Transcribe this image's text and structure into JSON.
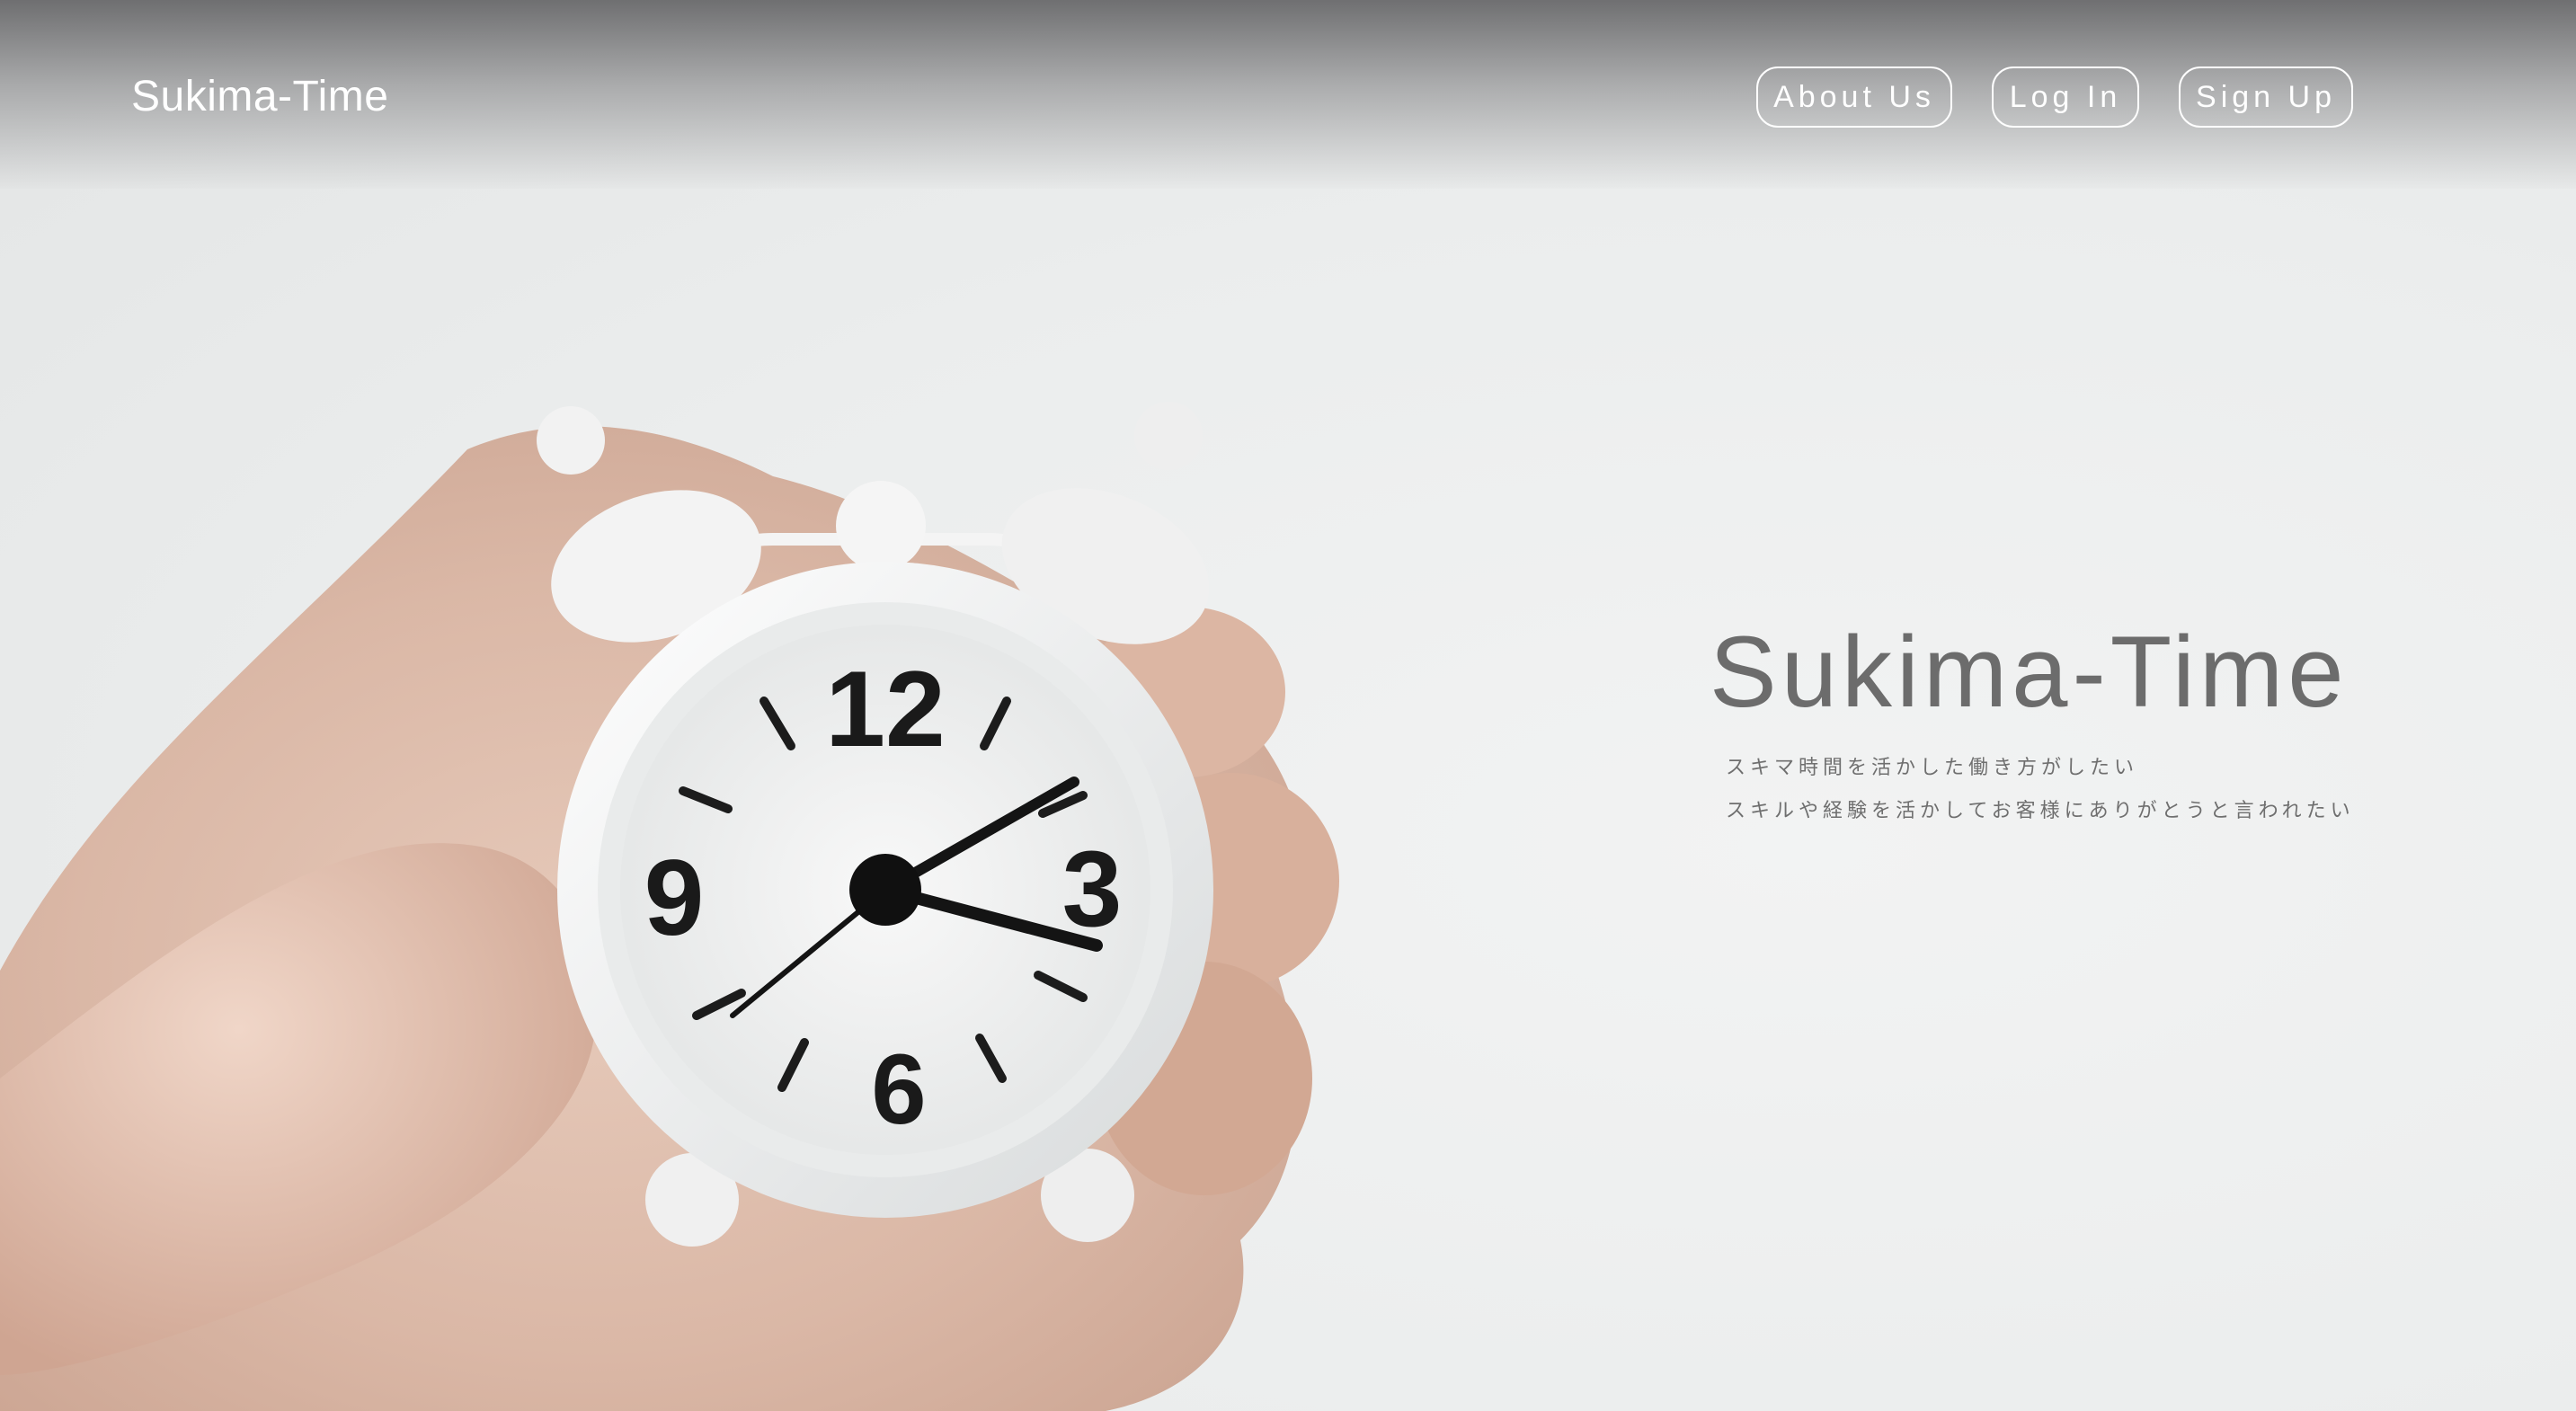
{
  "header": {
    "brand": "Sukima-Time",
    "nav": [
      {
        "label": "About Us"
      },
      {
        "label": "Log In"
      },
      {
        "label": "Sign Up"
      }
    ]
  },
  "hero": {
    "title": "Sukima-Time",
    "taglines": [
      "スキマ時間を活かした働き方がしたい",
      "スキルや経験を活かしてお客様にありがとうと言われたい"
    ],
    "image": {
      "subject": "hand holding white alarm clock",
      "clock_numerals": [
        "12",
        "3",
        "6",
        "9"
      ]
    }
  },
  "colors": {
    "background": "#eceeee",
    "header_text": "#ffffff",
    "title_text": "#6c6c6c"
  }
}
